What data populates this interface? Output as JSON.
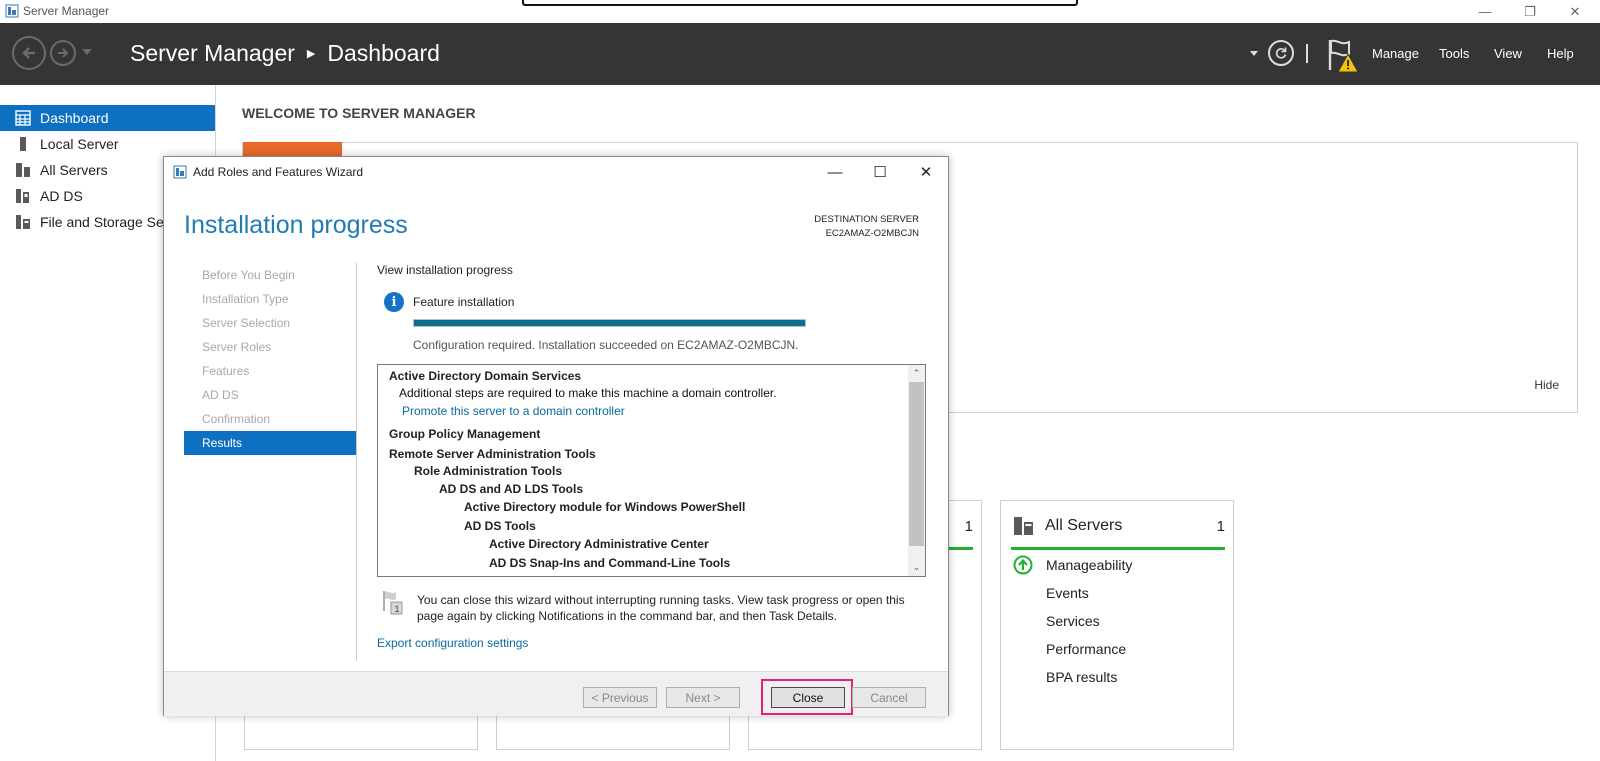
{
  "window": {
    "title": "Server Manager"
  },
  "header": {
    "breadcrumb_root": "Server Manager",
    "breadcrumb_page": "Dashboard",
    "menu": [
      "Manage",
      "Tools",
      "View",
      "Help"
    ]
  },
  "sidebar": {
    "items": [
      {
        "label": "Dashboard",
        "icon": "dashboard-icon",
        "active": true
      },
      {
        "label": "Local Server",
        "icon": "server-icon"
      },
      {
        "label": "All Servers",
        "icon": "servers-icon"
      },
      {
        "label": "AD DS",
        "icon": "ad-ds-icon"
      },
      {
        "label": "File and Storage Services",
        "icon": "storage-icon"
      }
    ]
  },
  "main": {
    "welcome_title": "WELCOME TO SERVER MANAGER",
    "hide_label": "Hide",
    "tiles": [
      {
        "title": "",
        "count": ""
      },
      {
        "title": "",
        "count": ""
      },
      {
        "title": "",
        "count": "1"
      },
      {
        "title": "All Servers",
        "count": "1",
        "rows": [
          "Manageability",
          "Events",
          "Services",
          "Performance",
          "BPA results"
        ]
      }
    ]
  },
  "dialog": {
    "title": "Add Roles and Features Wizard",
    "heading": "Installation progress",
    "destination_label": "DESTINATION SERVER",
    "destination_server": "EC2AMAZ-O2MBCJN",
    "steps": [
      "Before You Begin",
      "Installation Type",
      "Server Selection",
      "Server Roles",
      "Features",
      "AD DS",
      "Confirmation",
      "Results"
    ],
    "active_step": "Results",
    "subtitle": "View installation progress",
    "feature_label": "Feature installation",
    "progress_fraction": 1.0,
    "status": "Configuration required. Installation succeeded on EC2AMAZ-O2MBCJN.",
    "results": [
      {
        "text": "Active Directory Domain Services",
        "bold": true
      },
      {
        "text": "Additional steps are required to make this machine a domain controller."
      },
      {
        "text": "Promote this server to a domain controller",
        "link": true
      },
      {
        "text": "Group Policy Management",
        "bold": true
      },
      {
        "text": "Remote Server Administration Tools",
        "bold": true
      },
      {
        "text": "Role Administration Tools",
        "bold": true
      },
      {
        "text": "AD DS and AD LDS Tools",
        "bold": true
      },
      {
        "text": "Active Directory module for Windows PowerShell",
        "bold": true
      },
      {
        "text": "AD DS Tools",
        "bold": true
      },
      {
        "text": "Active Directory Administrative Center",
        "bold": true
      },
      {
        "text": "AD DS Snap-Ins and Command-Line Tools",
        "bold": true
      }
    ],
    "note": "You can close this wizard without interrupting running tasks. View task progress or open this page again by clicking Notifications in the command bar, and then Task Details.",
    "export_link": "Export configuration settings",
    "buttons": {
      "previous": "< Previous",
      "next": "Next >",
      "close": "Close",
      "cancel": "Cancel"
    }
  },
  "colors": {
    "header_bg": "#353535",
    "accent": "#0e70c0",
    "heading": "#1f7bb4",
    "status_green": "#23b12f",
    "orange": "#e8692a",
    "highlight": "#e6207a"
  }
}
